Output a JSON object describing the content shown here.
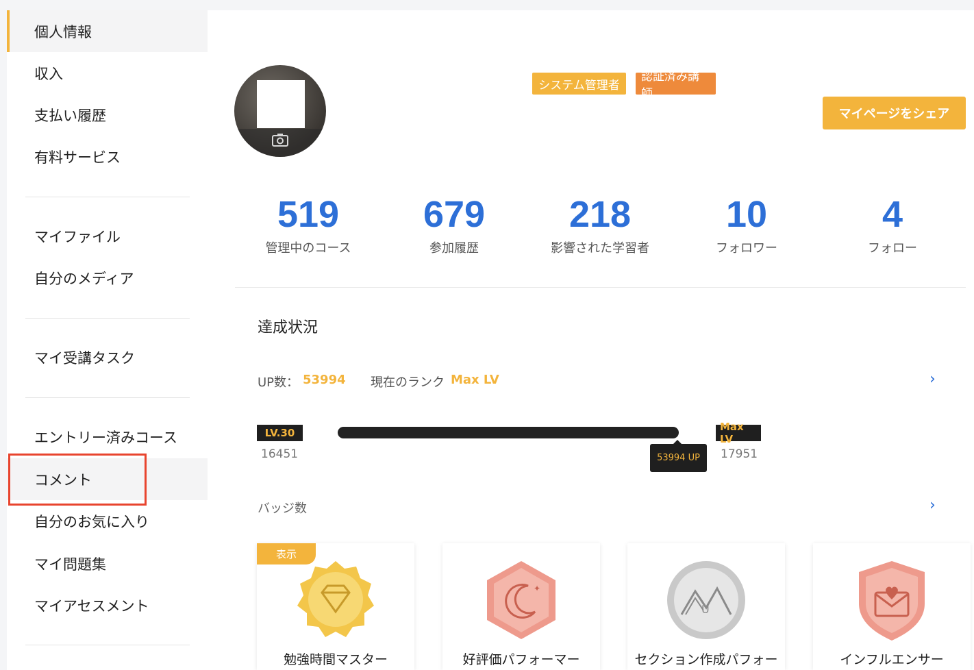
{
  "sidebar": {
    "items": [
      {
        "label": "個人情報"
      },
      {
        "label": "収入"
      },
      {
        "label": "支払い履歴"
      },
      {
        "label": "有料サービス"
      },
      {
        "label": "マイファイル"
      },
      {
        "label": "自分のメディア"
      },
      {
        "label": "マイ受講タスク"
      },
      {
        "label": "エントリー済みコース"
      },
      {
        "label": "コメント"
      },
      {
        "label": "自分のお気に入り"
      },
      {
        "label": "マイ問題集"
      },
      {
        "label": "マイアセスメント"
      }
    ]
  },
  "profile": {
    "tags": [
      "システム管理者",
      "認証済み講師"
    ],
    "share_label": "マイページをシェア"
  },
  "stats": [
    {
      "value": "519",
      "label": "管理中のコース"
    },
    {
      "value": "679",
      "label": "参加履歴"
    },
    {
      "value": "218",
      "label": "影響された学習者"
    },
    {
      "value": "10",
      "label": "フォロワー"
    },
    {
      "value": "4",
      "label": "フォロー"
    }
  ],
  "achievement": {
    "title": "達成状況",
    "up_label": "UP数：",
    "up_value": "53994",
    "rank_label": "現在のランク",
    "rank_value": "Max LV",
    "level_start": "LV.30",
    "level_end": "Max LV",
    "start_points": "16451",
    "end_points": "17951",
    "progress_percent": 100,
    "progress_tooltip": "53994 UP",
    "badge_count_label": "バッジ数"
  },
  "badges": [
    {
      "name": "勉強時間マスター",
      "tag": "表示",
      "icon": "diamond-icon",
      "color": "#f3c64a"
    },
    {
      "name": "好評価パフォーマー",
      "icon": "moon-icon",
      "color": "#ee9a8c"
    },
    {
      "name": "セクション作成パフォー",
      "icon": "mountain-icon",
      "color": "#c9c9c9"
    },
    {
      "name": "インフルエンサー",
      "icon": "heart-mail-icon",
      "color": "#ee9a8c"
    }
  ],
  "colors": {
    "accent": "#f3b43c",
    "blue": "#2d6fd7",
    "highlight": "#e8442e"
  }
}
